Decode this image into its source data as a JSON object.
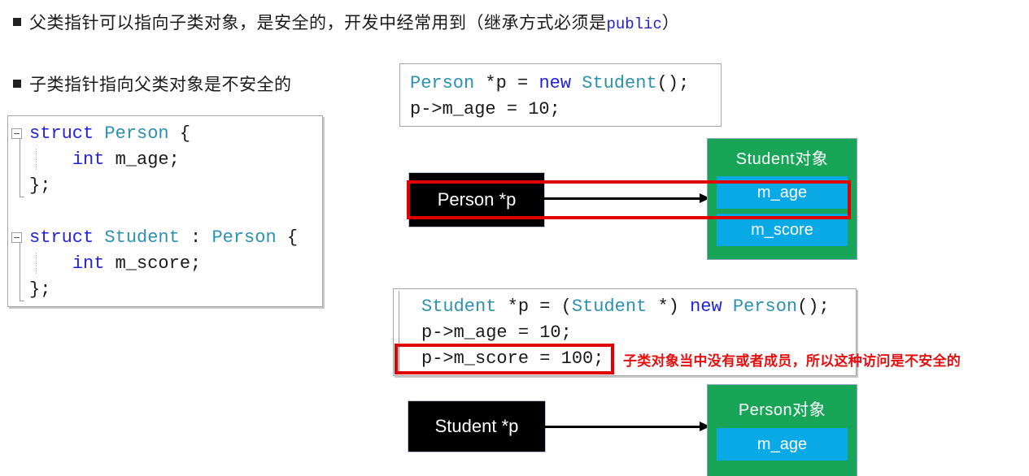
{
  "slide": {
    "bullets": [
      {
        "id": "bullet-parent-pointer",
        "text_before": "父类指针可以指向子类对象，是安全的，开发中经常用到（继承方式必须是",
        "keyword": "public",
        "text_after": "）"
      },
      {
        "id": "bullet-child-pointer",
        "text": "子类指针指向父类对象是不安全的"
      }
    ],
    "code_left": {
      "lines": [
        {
          "tokens": [
            {
              "t": "struct ",
              "c": "kw"
            },
            {
              "t": "Person",
              "c": "type"
            },
            {
              "t": " {",
              "c": "plain"
            }
          ],
          "fold": true
        },
        {
          "tokens": [
            {
              "t": "    ",
              "c": "plain"
            },
            {
              "t": "int",
              "c": "kw"
            },
            {
              "t": " m_age;",
              "c": "plain"
            }
          ],
          "fold": false
        },
        {
          "tokens": [
            {
              "t": "};",
              "c": "plain"
            }
          ],
          "fold": false
        },
        {
          "tokens": [
            {
              "t": "",
              "c": "plain"
            }
          ],
          "fold": false
        },
        {
          "tokens": [
            {
              "t": "struct ",
              "c": "kw"
            },
            {
              "t": "Student",
              "c": "type"
            },
            {
              "t": " : ",
              "c": "plain"
            },
            {
              "t": "Person",
              "c": "type"
            },
            {
              "t": " {",
              "c": "plain"
            }
          ],
          "fold": true
        },
        {
          "tokens": [
            {
              "t": "    ",
              "c": "plain"
            },
            {
              "t": "int",
              "c": "kw"
            },
            {
              "t": " m_score;",
              "c": "plain"
            }
          ],
          "fold": false
        },
        {
          "tokens": [
            {
              "t": "};",
              "c": "plain"
            }
          ],
          "fold": false
        }
      ]
    },
    "code_top": {
      "lines": [
        {
          "tokens": [
            {
              "t": "Person",
              "c": "type"
            },
            {
              "t": " *p = ",
              "c": "plain"
            },
            {
              "t": "new",
              "c": "kw"
            },
            {
              "t": " ",
              "c": "plain"
            },
            {
              "t": "Student",
              "c": "type"
            },
            {
              "t": "();",
              "c": "plain"
            }
          ]
        },
        {
          "tokens": [
            {
              "t": "p->m_age = ",
              "c": "plain"
            },
            {
              "t": "10",
              "c": "num"
            },
            {
              "t": ";",
              "c": "plain"
            }
          ]
        }
      ]
    },
    "code_mid": {
      "lines": [
        {
          "tokens": [
            {
              "t": "Student",
              "c": "type"
            },
            {
              "t": " *p = (",
              "c": "plain"
            },
            {
              "t": "Student",
              "c": "type"
            },
            {
              "t": " *) ",
              "c": "plain"
            },
            {
              "t": "new",
              "c": "kw"
            },
            {
              "t": " ",
              "c": "plain"
            },
            {
              "t": "Person",
              "c": "type"
            },
            {
              "t": "();",
              "c": "plain"
            }
          ]
        },
        {
          "tokens": [
            {
              "t": "p->m_age = ",
              "c": "plain"
            },
            {
              "t": "10",
              "c": "num"
            },
            {
              "t": ";",
              "c": "plain"
            }
          ]
        },
        {
          "tokens": [
            {
              "t": "p->m_score = ",
              "c": "plain"
            },
            {
              "t": "100",
              "c": "num"
            },
            {
              "t": ";",
              "c": "plain"
            }
          ]
        }
      ]
    },
    "diagram_top": {
      "pointer_label": "Person *p",
      "object_title": "Student对象",
      "fields": [
        "m_age",
        "m_score"
      ]
    },
    "diagram_bottom": {
      "pointer_label": "Student *p",
      "object_title": "Person对象",
      "fields": [
        "m_age"
      ]
    },
    "annotation": {
      "red_note": "子类对象当中没有或者成员，所以这种访问是不安全的"
    },
    "colors": {
      "green": "#18a558",
      "blue": "#09a9e6",
      "red": "#e00000",
      "keyword": "#2222dd",
      "type": "#2b91af",
      "black": "#000000"
    }
  }
}
